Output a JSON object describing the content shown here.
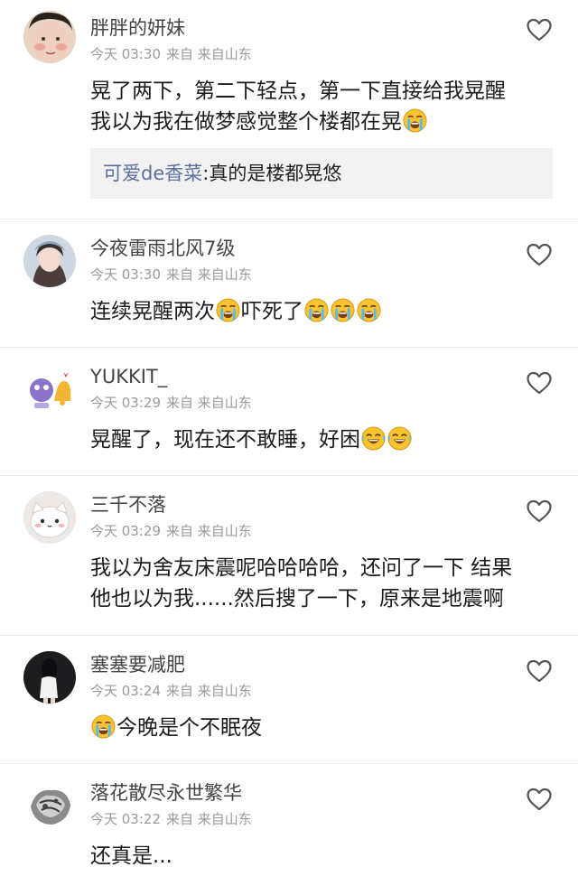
{
  "comments": [
    {
      "name": "胖胖的妍妹",
      "time": "今天 03:30",
      "source": "来自 来自山东",
      "lines": [
        "晃了两下，第二下轻点，第一下直接给我晃醒",
        "我以为我在做梦感觉整个楼都在晃"
      ],
      "reply": {
        "user": "可爱de香菜",
        "text": ":真的是楼都晃悠"
      }
    },
    {
      "name": "今夜雷雨北风7级",
      "time": "今天 03:30",
      "source": "来自 来自山东",
      "text_a": "连续晃醒两次",
      "text_b": "吓死了"
    },
    {
      "name": "YUKKIT_",
      "time": "今天 03:29",
      "source": "来自 来自山东",
      "text": "晃醒了，现在还不敢睡，好困"
    },
    {
      "name": "三千不落",
      "time": "今天 03:29",
      "source": "来自 来自山东",
      "lines": [
        "我以为舍友床震呢哈哈哈哈，还问了一下 结果",
        "他也以为我......然后搜了一下，原来是地震啊"
      ]
    },
    {
      "name": "塞塞要减肥",
      "time": "今天 03:24",
      "source": "来自 来自山东",
      "text": "今晚是个不眠夜"
    },
    {
      "name": "落花散尽永世繁华",
      "time": "今天 03:22",
      "source": "来自 来自山东",
      "text": "还真是..."
    }
  ],
  "icons": {
    "like": "heart-outline-icon",
    "cry": "loudly-crying-emoji",
    "laugh": "tears-of-joy-emoji"
  },
  "colors": {
    "name": "#444444",
    "meta": "#9a9a9a",
    "reply_user": "#5b6f9c",
    "reply_bg": "#f2f2f2",
    "divider": "#ebebeb"
  }
}
